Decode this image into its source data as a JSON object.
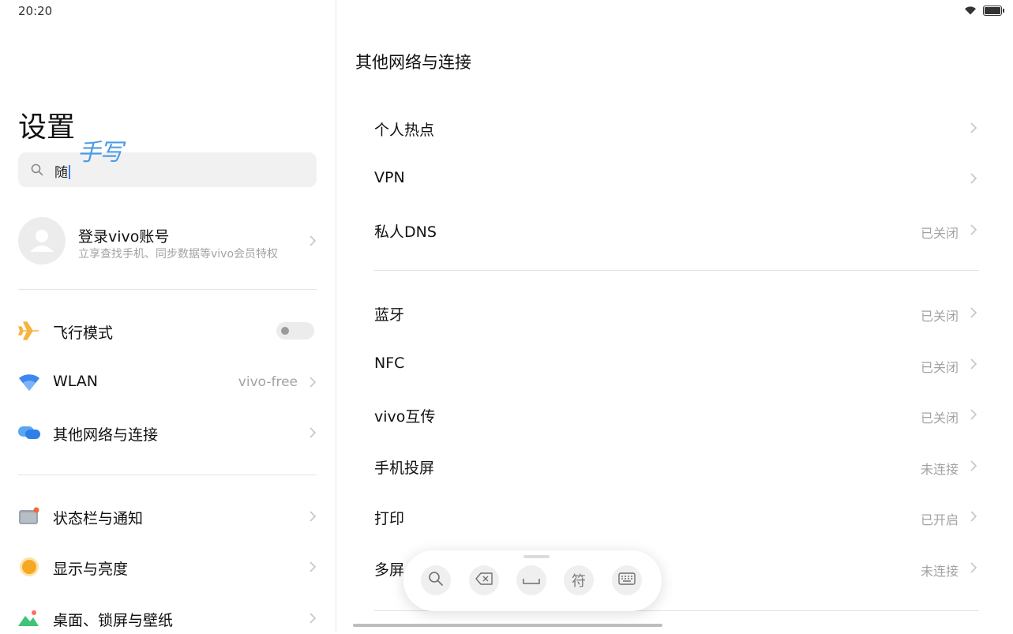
{
  "status_bar": {
    "time": "20:20"
  },
  "left": {
    "title": "设置",
    "search": {
      "value": "随",
      "handwriting_label": "手写"
    },
    "account": {
      "title": "登录vivo账号",
      "subtitle": "立享查找手机、同步数据等vivo会员特权"
    },
    "items": [
      {
        "label": "飞行模式",
        "icon": "airplane-icon",
        "toggle_on": false
      },
      {
        "label": "WLAN",
        "icon": "wifi-icon",
        "value": "vivo-free"
      },
      {
        "label": "其他网络与连接",
        "icon": "connections-icon"
      },
      {
        "label": "状态栏与通知",
        "icon": "statusbar-icon"
      },
      {
        "label": "显示与亮度",
        "icon": "brightness-icon"
      },
      {
        "label": "桌面、锁屏与壁纸",
        "icon": "wallpaper-icon"
      }
    ]
  },
  "right": {
    "title": "其他网络与连接",
    "items": [
      {
        "label": "个人热点",
        "value": ""
      },
      {
        "label": "VPN",
        "value": ""
      },
      {
        "label": "私人DNS",
        "value": "已关闭"
      },
      {
        "label": "蓝牙",
        "value": "已关闭"
      },
      {
        "label": "NFC",
        "value": "已关闭"
      },
      {
        "label": "vivo互传",
        "value": "已关闭"
      },
      {
        "label": "手机投屏",
        "value": "未连接"
      },
      {
        "label": "打印",
        "value": "已开启"
      },
      {
        "label": "多屏",
        "value": "未连接"
      }
    ]
  },
  "toolbar": {
    "symbols_label": "符"
  },
  "colors": {
    "accent": "#3b7ff5",
    "handwriting": "#4c9be6",
    "secondary_text": "#a3a3a3"
  }
}
